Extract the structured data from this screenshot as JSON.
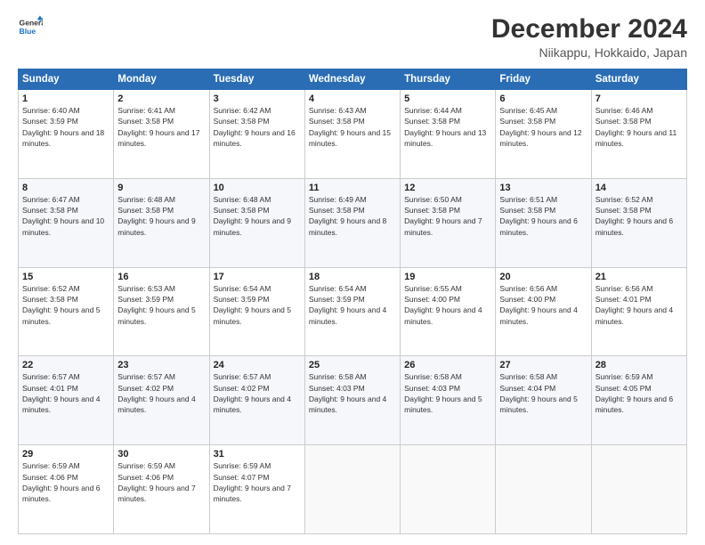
{
  "header": {
    "logo_line1": "General",
    "logo_line2": "Blue",
    "month_title": "December 2024",
    "subtitle": "Niikappu, Hokkaido, Japan"
  },
  "weekdays": [
    "Sunday",
    "Monday",
    "Tuesday",
    "Wednesday",
    "Thursday",
    "Friday",
    "Saturday"
  ],
  "weeks": [
    [
      {
        "day": "1",
        "sunrise": "6:40 AM",
        "sunset": "3:59 PM",
        "daylight": "9 hours and 18 minutes."
      },
      {
        "day": "2",
        "sunrise": "6:41 AM",
        "sunset": "3:58 PM",
        "daylight": "9 hours and 17 minutes."
      },
      {
        "day": "3",
        "sunrise": "6:42 AM",
        "sunset": "3:58 PM",
        "daylight": "9 hours and 16 minutes."
      },
      {
        "day": "4",
        "sunrise": "6:43 AM",
        "sunset": "3:58 PM",
        "daylight": "9 hours and 15 minutes."
      },
      {
        "day": "5",
        "sunrise": "6:44 AM",
        "sunset": "3:58 PM",
        "daylight": "9 hours and 13 minutes."
      },
      {
        "day": "6",
        "sunrise": "6:45 AM",
        "sunset": "3:58 PM",
        "daylight": "9 hours and 12 minutes."
      },
      {
        "day": "7",
        "sunrise": "6:46 AM",
        "sunset": "3:58 PM",
        "daylight": "9 hours and 11 minutes."
      }
    ],
    [
      {
        "day": "8",
        "sunrise": "6:47 AM",
        "sunset": "3:58 PM",
        "daylight": "9 hours and 10 minutes."
      },
      {
        "day": "9",
        "sunrise": "6:48 AM",
        "sunset": "3:58 PM",
        "daylight": "9 hours and 9 minutes."
      },
      {
        "day": "10",
        "sunrise": "6:48 AM",
        "sunset": "3:58 PM",
        "daylight": "9 hours and 9 minutes."
      },
      {
        "day": "11",
        "sunrise": "6:49 AM",
        "sunset": "3:58 PM",
        "daylight": "9 hours and 8 minutes."
      },
      {
        "day": "12",
        "sunrise": "6:50 AM",
        "sunset": "3:58 PM",
        "daylight": "9 hours and 7 minutes."
      },
      {
        "day": "13",
        "sunrise": "6:51 AM",
        "sunset": "3:58 PM",
        "daylight": "9 hours and 6 minutes."
      },
      {
        "day": "14",
        "sunrise": "6:52 AM",
        "sunset": "3:58 PM",
        "daylight": "9 hours and 6 minutes."
      }
    ],
    [
      {
        "day": "15",
        "sunrise": "6:52 AM",
        "sunset": "3:58 PM",
        "daylight": "9 hours and 5 minutes."
      },
      {
        "day": "16",
        "sunrise": "6:53 AM",
        "sunset": "3:59 PM",
        "daylight": "9 hours and 5 minutes."
      },
      {
        "day": "17",
        "sunrise": "6:54 AM",
        "sunset": "3:59 PM",
        "daylight": "9 hours and 5 minutes."
      },
      {
        "day": "18",
        "sunrise": "6:54 AM",
        "sunset": "3:59 PM",
        "daylight": "9 hours and 4 minutes."
      },
      {
        "day": "19",
        "sunrise": "6:55 AM",
        "sunset": "4:00 PM",
        "daylight": "9 hours and 4 minutes."
      },
      {
        "day": "20",
        "sunrise": "6:56 AM",
        "sunset": "4:00 PM",
        "daylight": "9 hours and 4 minutes."
      },
      {
        "day": "21",
        "sunrise": "6:56 AM",
        "sunset": "4:01 PM",
        "daylight": "9 hours and 4 minutes."
      }
    ],
    [
      {
        "day": "22",
        "sunrise": "6:57 AM",
        "sunset": "4:01 PM",
        "daylight": "9 hours and 4 minutes."
      },
      {
        "day": "23",
        "sunrise": "6:57 AM",
        "sunset": "4:02 PM",
        "daylight": "9 hours and 4 minutes."
      },
      {
        "day": "24",
        "sunrise": "6:57 AM",
        "sunset": "4:02 PM",
        "daylight": "9 hours and 4 minutes."
      },
      {
        "day": "25",
        "sunrise": "6:58 AM",
        "sunset": "4:03 PM",
        "daylight": "9 hours and 4 minutes."
      },
      {
        "day": "26",
        "sunrise": "6:58 AM",
        "sunset": "4:03 PM",
        "daylight": "9 hours and 5 minutes."
      },
      {
        "day": "27",
        "sunrise": "6:58 AM",
        "sunset": "4:04 PM",
        "daylight": "9 hours and 5 minutes."
      },
      {
        "day": "28",
        "sunrise": "6:59 AM",
        "sunset": "4:05 PM",
        "daylight": "9 hours and 6 minutes."
      }
    ],
    [
      {
        "day": "29",
        "sunrise": "6:59 AM",
        "sunset": "4:06 PM",
        "daylight": "9 hours and 6 minutes."
      },
      {
        "day": "30",
        "sunrise": "6:59 AM",
        "sunset": "4:06 PM",
        "daylight": "9 hours and 7 minutes."
      },
      {
        "day": "31",
        "sunrise": "6:59 AM",
        "sunset": "4:07 PM",
        "daylight": "9 hours and 7 minutes."
      },
      null,
      null,
      null,
      null
    ]
  ],
  "labels": {
    "sunrise": "Sunrise:",
    "sunset": "Sunset:",
    "daylight": "Daylight:"
  }
}
